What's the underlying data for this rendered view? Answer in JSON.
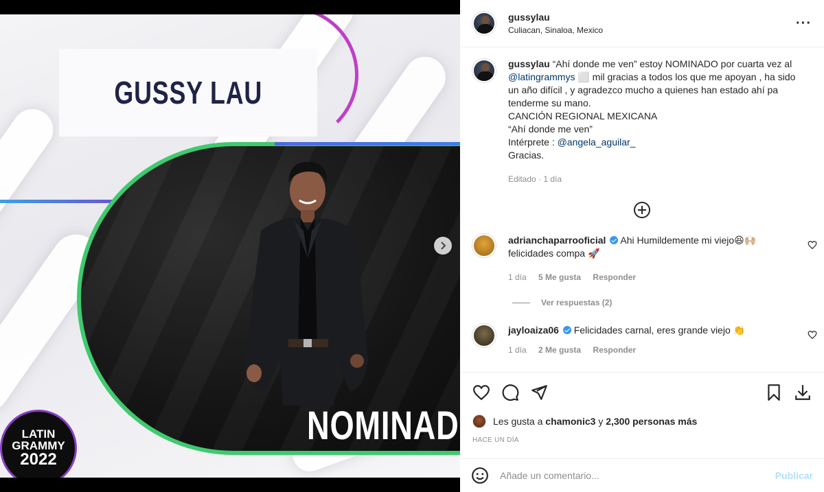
{
  "post": {
    "username": "gussylau",
    "location": "Culiacan, Sinaloa, Mexico",
    "more_icon": "more-horizontal-icon"
  },
  "media": {
    "nameplate_text": "GUSSY LAU",
    "banner_text": "NOMINADO",
    "grammy_line1": "LATIN",
    "grammy_line2": "GRAMMY",
    "grammy_line3": "2022",
    "accent_colors": [
      "#c03fc7",
      "#3fca6e",
      "#3aa0e6",
      "#8a3fc2"
    ]
  },
  "caption": {
    "username": "gussylau",
    "text_1": "“Ahí donde me ven” estoy NOMINADO por cuarta vez al",
    "mention_1": "@latingrammys",
    "text_2": "⬜ mil gracias a todos los que me apoyan , ha sido un año difícil , y agradezco mucho a quienes han estado ahí pa tenderme su mano.",
    "line_3": "CANCIÓN REGIONAL MEXICANA",
    "line_4": "“Ahí donde me ven”",
    "line_5_prefix": "Intérprete :",
    "mention_2": "@angela_aguilar_",
    "line_6": "Gracias.",
    "meta": "Editado · 1 día"
  },
  "comments": [
    {
      "username": "adrianchaparrooficial",
      "verified": true,
      "text": "Ahi Humildemente mi viejo😆🙌🏼",
      "text_2": "felicidades compa 🚀",
      "time": "1 día",
      "likes": "5 Me gusta",
      "reply": "Responder",
      "view_replies": "Ver respuestas (2)"
    },
    {
      "username": "jayloaiza06",
      "verified": true,
      "text": "Felicidades carnal, eres grande viejo 👏",
      "time": "1 día",
      "likes": "2 Me gusta",
      "reply": "Responder"
    }
  ],
  "likes": {
    "prefix": "Les gusta a",
    "user": "chamonic3",
    "middle": "y",
    "count": "2,300 personas más"
  },
  "date": "HACE UN DÍA",
  "comment_box": {
    "placeholder": "Añade un comentario...",
    "publish": "Publicar"
  }
}
